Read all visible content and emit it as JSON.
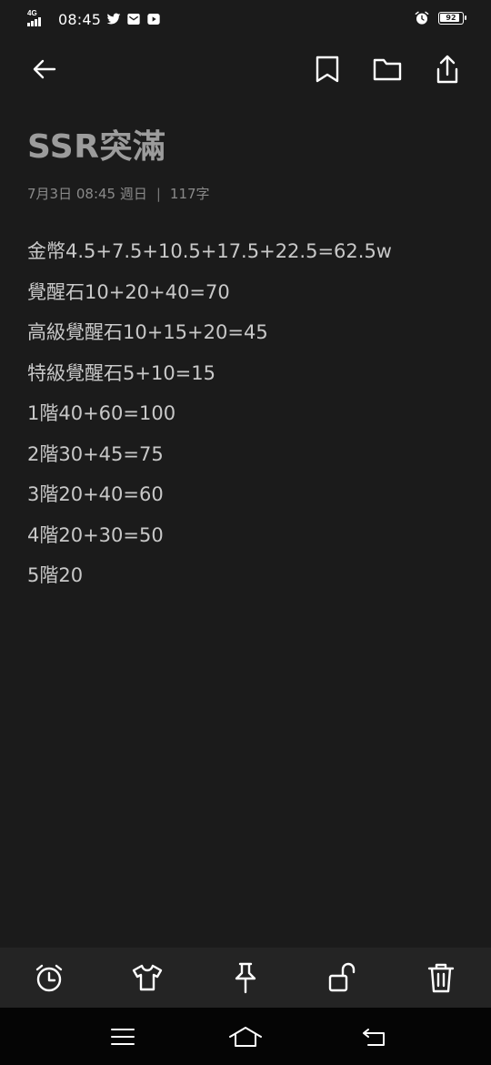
{
  "status_bar": {
    "network": "4G",
    "time": "08:45",
    "battery": "92",
    "battery_fraction": 0.92,
    "left_icons": [
      "signal-icon",
      "twitter-icon",
      "mail-icon",
      "play-icon"
    ],
    "right_icons": [
      "alarm-icon",
      "battery-icon"
    ]
  },
  "toolbar": {
    "icons": [
      "back-arrow-icon",
      "bookmark-icon",
      "folder-icon",
      "share-icon"
    ]
  },
  "note": {
    "title": "SSR突滿",
    "date": "7月3日 08:45 週日",
    "separator": "|",
    "char_count": "117字",
    "lines": [
      "金幣4.5+7.5+10.5+17.5+22.5=62.5w",
      "覺醒石10+20+40=70",
      "高級覺醒石10+15+20=45",
      "特級覺醒石5+10=15",
      "1階40+60=100",
      "2階30+45=75",
      "3階20+40=60",
      "4階20+30=50",
      "5階20"
    ]
  },
  "bottom_toolbar": {
    "icons": [
      "alarm-clock-icon",
      "tshirt-icon",
      "pin-icon",
      "unlock-icon",
      "trash-icon"
    ]
  },
  "nav_bar": {
    "icons": [
      "menu-icon",
      "home-icon",
      "back-icon"
    ]
  },
  "colors": {
    "background": "#1b1b1b",
    "toolbar_bg": "#242424",
    "nav_bg": "#050505",
    "title": "#9c9c9c",
    "body_text": "#c8c8c8",
    "meta_text": "#8a8a8a",
    "icon": "#ffffff"
  }
}
